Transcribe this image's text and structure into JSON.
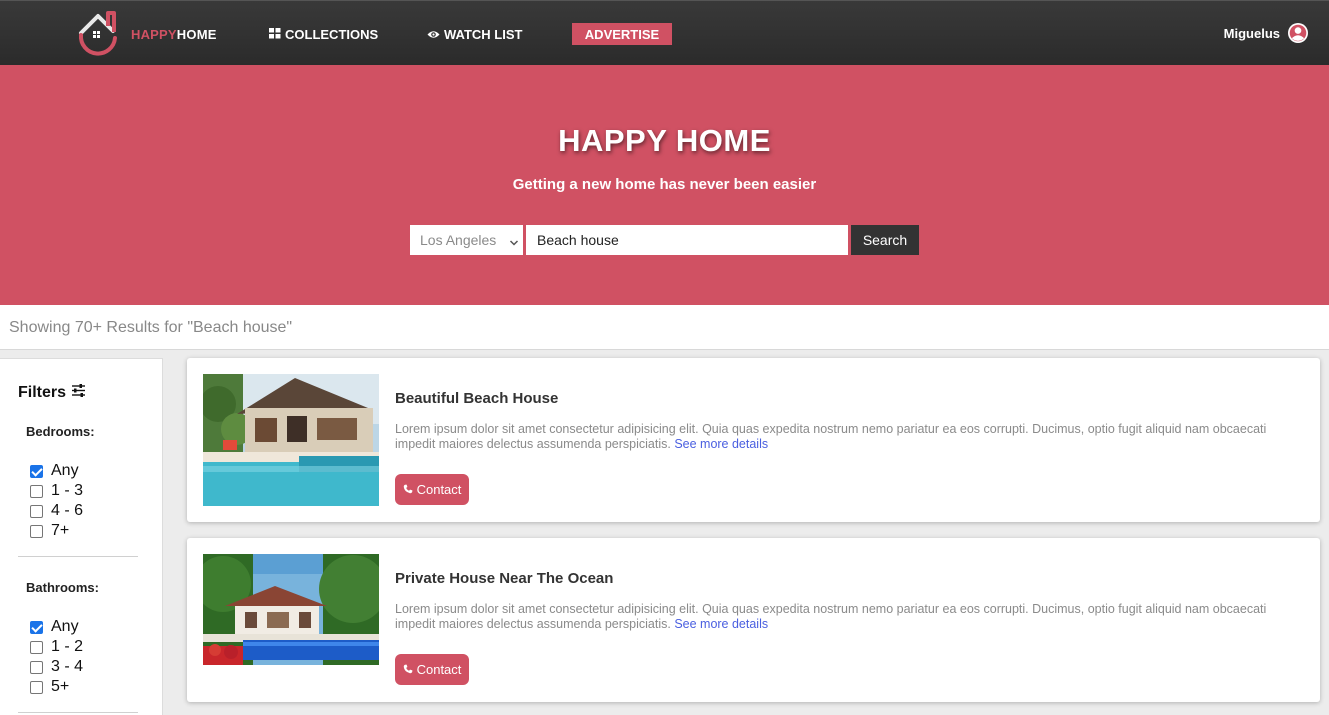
{
  "navbar": {
    "brand_part1": "HAPPY",
    "brand_part2": "HOME",
    "collections_label": "COLLECTIONS",
    "watchlist_label": "WATCH LIST",
    "advertise_label": "ADVERTISE",
    "username": "Miguelus",
    "logo_icon": "house-logo-icon",
    "collections_icon": "grid-icon",
    "watchlist_icon": "eye-icon",
    "user_icon": "user-circle-icon"
  },
  "hero": {
    "title": "HAPPY HOME",
    "subtitle": "Getting a new home has never been easier",
    "city_selected": "Los Angeles",
    "search_value": "Beach house",
    "search_button": "Search"
  },
  "results": {
    "text": "Showing 70+ Results for \"Beach house\""
  },
  "filters": {
    "title": "Filters",
    "bedrooms": {
      "label": "Bedrooms:",
      "options": [
        {
          "label": "Any",
          "checked": true
        },
        {
          "label": "1 - 3",
          "checked": false
        },
        {
          "label": "4 - 6",
          "checked": false
        },
        {
          "label": "7+",
          "checked": false
        }
      ]
    },
    "bathrooms": {
      "label": "Bathrooms:",
      "options": [
        {
          "label": "Any",
          "checked": true
        },
        {
          "label": "1 - 2",
          "checked": false
        },
        {
          "label": "3 - 4",
          "checked": false
        },
        {
          "label": "5+",
          "checked": false
        }
      ]
    }
  },
  "listings": [
    {
      "title": "Beautiful Beach House",
      "description": "Lorem ipsum dolor sit amet consectetur adipisicing elit. Quia quas expedita nostrum nemo pariatur ea eos corrupti. Ducimus, optio fugit aliquid nam obcaecati impedit maiores delectus assumenda perspiciatis.",
      "see_more": "See more details",
      "contact_label": "Contact"
    },
    {
      "title": "Private House Near The Ocean",
      "description": "Lorem ipsum dolor sit amet consectetur adipisicing elit. Quia quas expedita nostrum nemo pariatur ea eos corrupti. Ducimus, optio fugit aliquid nam obcaecati impedit maiores delectus assumenda perspiciatis.",
      "see_more": "See more details",
      "contact_label": "Contact"
    }
  ],
  "colors": {
    "brand": "#d05163",
    "navbar": "#333333",
    "link": "#4a5fe0"
  }
}
